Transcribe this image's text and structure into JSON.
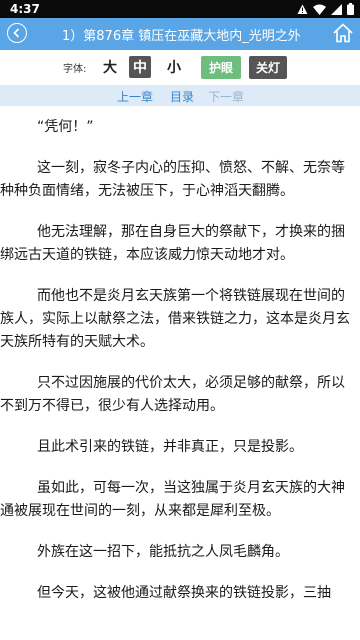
{
  "status_bar": {
    "time": "4:37",
    "icons": [
      "warning-icon",
      "wifi-icon",
      "signal-icon",
      "battery-icon"
    ]
  },
  "header": {
    "title": "1）第876章 镇压在巫藏大地内_光明之外",
    "back_icon": "back-arrow-icon",
    "home_icon": "home-icon",
    "bg_color": "#5aa5e6"
  },
  "controls": {
    "font_label": "字体:",
    "size_large": "大",
    "size_medium": "中",
    "size_small": "小",
    "selected_size": "中",
    "eye_mode": "护眼",
    "night_mode": "关灯",
    "eye_color": "#6dbd7e",
    "night_color": "#555555"
  },
  "nav": {
    "prev": "上一章",
    "toc": "目录",
    "next": "下一章"
  },
  "content": {
    "paragraphs": [
      "“凭何！”",
      "这一刻，寂冬子内心的压抑、愤怒、不解、无奈等种种负面情绪，无法被压下，于心神滔天翻腾。",
      "他无法理解，那在自身巨大的祭献下，才换来的捆绑远古天道的铁链，本应该威力惊天动地才对。",
      "而他也不是炎月玄天族第一个将铁链展现在世间的族人，实际上以献祭之法，借来铁链之力，这本是炎月玄天族所特有的天赋大术。",
      "只不过因施展的代价太大，必须足够的献祭，所以不到万不得已，很少有人选择动用。",
      "且此术引来的铁链，并非真正，只是投影。",
      "虽如此，可每一次，当这独属于炎月玄天族的大神通被展现在世间的一刻，从来都是犀利至极。",
      "外族在这一招下，能抵抗之人凤毛麟角。",
      "但今天，这被他通过献祭换来的铁链投影，三抽"
    ]
  }
}
